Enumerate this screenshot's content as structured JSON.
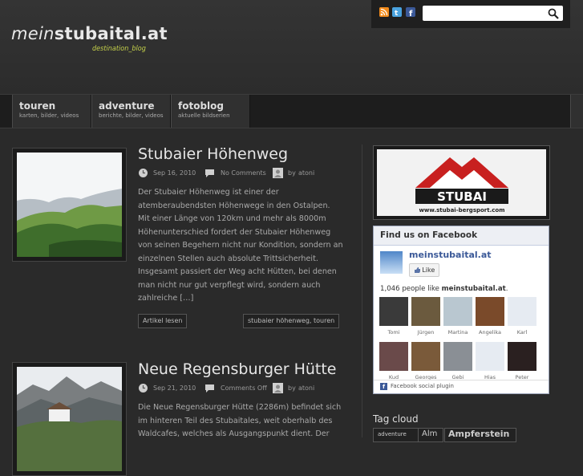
{
  "site": {
    "logo_prefix": "mein",
    "logo_name": "stubaital.at",
    "tagline": "destination_blog"
  },
  "search": {
    "placeholder": ""
  },
  "social_icons": [
    "rss-icon",
    "twitter-icon",
    "facebook-icon"
  ],
  "nav": [
    {
      "title": "touren",
      "subtitle": "karten, bilder, videos"
    },
    {
      "title": "adventure",
      "subtitle": "berichte, bilder, videos"
    },
    {
      "title": "fotoblog",
      "subtitle": "aktuelle bildserien"
    }
  ],
  "posts": [
    {
      "title": "Stubaier Höhenweg",
      "date": "Sep 16, 2010",
      "comments": "No Comments",
      "author_prefix": "by",
      "author": "atoni",
      "excerpt": "Der Stubaier Höhenweg ist einer der atemberaubendsten Höhenwege in den Ostalpen. Mit einer Länge von 120km und mehr als 8000m Höhenunterschied fordert der Stubaier Höhenweg von seinen Begehern nicht nur Kondition, sondern an einzelnen Stellen auch absolute Trittsicherheit. Insgesamt passiert der Weg acht Hütten, bei denen man nicht nur gut verpflegt wird, sondern auch zahlreiche […]",
      "read_more": "Artikel lesen",
      "tags": "stubaier höhenweg, touren"
    },
    {
      "title": "Neue Regensburger Hütte",
      "date": "Sep 21, 2010",
      "comments": "Comments Off",
      "author_prefix": "by",
      "author": "atoni",
      "excerpt": "Die Neue Regensburger Hütte (2286m) befindet sich im hinteren Teil des Stubaitales, weit oberhalb des Waldcafes, welches als Ausgangspunkt dient. Der"
    }
  ],
  "sidebar": {
    "banner": {
      "brand": "STUBAI",
      "url": "www.stubai-bergsport.com"
    },
    "facebook": {
      "header": "Find us on Facebook",
      "page_name": "meinstubaital.at",
      "like_label": "Like",
      "count_text": "1,046 people like",
      "count_page": "meinstubaital.at",
      "count_suffix": ".",
      "fans": [
        "Tomi",
        "Jürgen",
        "Martina",
        "Angelika",
        "Karl",
        "Kud",
        "Georges",
        "Gebi",
        "Hias",
        "Peter"
      ],
      "footer": "Facebook social plugin"
    },
    "tag_cloud_title": "Tag cloud",
    "tags": [
      "adventure",
      "Alm",
      "Ampferstein"
    ]
  },
  "colors": {
    "accent_green": "#c5d14a",
    "facebook_blue": "#3b5998",
    "stubai_red": "#c8201f"
  }
}
